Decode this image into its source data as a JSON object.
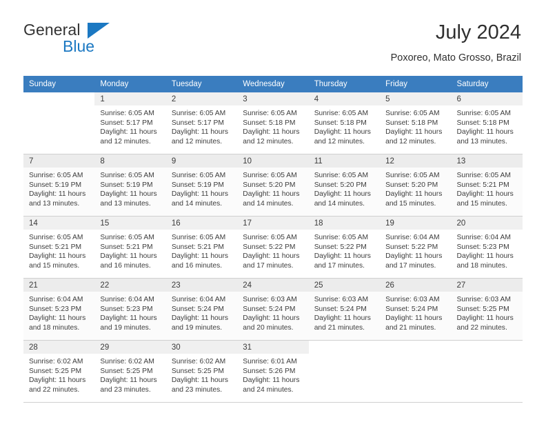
{
  "brand": {
    "name_dark": "General",
    "name_blue": "Blue",
    "accent_color": "#1b78c2"
  },
  "header": {
    "title": "July 2024",
    "subtitle": "Poxoreo, Mato Grosso, Brazil"
  },
  "calendar": {
    "header_bg": "#3a7dbf",
    "weekday_headers": [
      "Sunday",
      "Monday",
      "Tuesday",
      "Wednesday",
      "Thursday",
      "Friday",
      "Saturday"
    ],
    "weeks": [
      [
        {
          "day": "",
          "lines": []
        },
        {
          "day": "1",
          "lines": [
            "Sunrise: 6:05 AM",
            "Sunset: 5:17 PM",
            "Daylight: 11 hours",
            "and 12 minutes."
          ]
        },
        {
          "day": "2",
          "lines": [
            "Sunrise: 6:05 AM",
            "Sunset: 5:17 PM",
            "Daylight: 11 hours",
            "and 12 minutes."
          ]
        },
        {
          "day": "3",
          "lines": [
            "Sunrise: 6:05 AM",
            "Sunset: 5:18 PM",
            "Daylight: 11 hours",
            "and 12 minutes."
          ]
        },
        {
          "day": "4",
          "lines": [
            "Sunrise: 6:05 AM",
            "Sunset: 5:18 PM",
            "Daylight: 11 hours",
            "and 12 minutes."
          ]
        },
        {
          "day": "5",
          "lines": [
            "Sunrise: 6:05 AM",
            "Sunset: 5:18 PM",
            "Daylight: 11 hours",
            "and 12 minutes."
          ]
        },
        {
          "day": "6",
          "lines": [
            "Sunrise: 6:05 AM",
            "Sunset: 5:18 PM",
            "Daylight: 11 hours",
            "and 13 minutes."
          ]
        }
      ],
      [
        {
          "day": "7",
          "lines": [
            "Sunrise: 6:05 AM",
            "Sunset: 5:19 PM",
            "Daylight: 11 hours",
            "and 13 minutes."
          ]
        },
        {
          "day": "8",
          "lines": [
            "Sunrise: 6:05 AM",
            "Sunset: 5:19 PM",
            "Daylight: 11 hours",
            "and 13 minutes."
          ]
        },
        {
          "day": "9",
          "lines": [
            "Sunrise: 6:05 AM",
            "Sunset: 5:19 PM",
            "Daylight: 11 hours",
            "and 14 minutes."
          ]
        },
        {
          "day": "10",
          "lines": [
            "Sunrise: 6:05 AM",
            "Sunset: 5:20 PM",
            "Daylight: 11 hours",
            "and 14 minutes."
          ]
        },
        {
          "day": "11",
          "lines": [
            "Sunrise: 6:05 AM",
            "Sunset: 5:20 PM",
            "Daylight: 11 hours",
            "and 14 minutes."
          ]
        },
        {
          "day": "12",
          "lines": [
            "Sunrise: 6:05 AM",
            "Sunset: 5:20 PM",
            "Daylight: 11 hours",
            "and 15 minutes."
          ]
        },
        {
          "day": "13",
          "lines": [
            "Sunrise: 6:05 AM",
            "Sunset: 5:21 PM",
            "Daylight: 11 hours",
            "and 15 minutes."
          ]
        }
      ],
      [
        {
          "day": "14",
          "lines": [
            "Sunrise: 6:05 AM",
            "Sunset: 5:21 PM",
            "Daylight: 11 hours",
            "and 15 minutes."
          ]
        },
        {
          "day": "15",
          "lines": [
            "Sunrise: 6:05 AM",
            "Sunset: 5:21 PM",
            "Daylight: 11 hours",
            "and 16 minutes."
          ]
        },
        {
          "day": "16",
          "lines": [
            "Sunrise: 6:05 AM",
            "Sunset: 5:21 PM",
            "Daylight: 11 hours",
            "and 16 minutes."
          ]
        },
        {
          "day": "17",
          "lines": [
            "Sunrise: 6:05 AM",
            "Sunset: 5:22 PM",
            "Daylight: 11 hours",
            "and 17 minutes."
          ]
        },
        {
          "day": "18",
          "lines": [
            "Sunrise: 6:05 AM",
            "Sunset: 5:22 PM",
            "Daylight: 11 hours",
            "and 17 minutes."
          ]
        },
        {
          "day": "19",
          "lines": [
            "Sunrise: 6:04 AM",
            "Sunset: 5:22 PM",
            "Daylight: 11 hours",
            "and 17 minutes."
          ]
        },
        {
          "day": "20",
          "lines": [
            "Sunrise: 6:04 AM",
            "Sunset: 5:23 PM",
            "Daylight: 11 hours",
            "and 18 minutes."
          ]
        }
      ],
      [
        {
          "day": "21",
          "lines": [
            "Sunrise: 6:04 AM",
            "Sunset: 5:23 PM",
            "Daylight: 11 hours",
            "and 18 minutes."
          ]
        },
        {
          "day": "22",
          "lines": [
            "Sunrise: 6:04 AM",
            "Sunset: 5:23 PM",
            "Daylight: 11 hours",
            "and 19 minutes."
          ]
        },
        {
          "day": "23",
          "lines": [
            "Sunrise: 6:04 AM",
            "Sunset: 5:24 PM",
            "Daylight: 11 hours",
            "and 19 minutes."
          ]
        },
        {
          "day": "24",
          "lines": [
            "Sunrise: 6:03 AM",
            "Sunset: 5:24 PM",
            "Daylight: 11 hours",
            "and 20 minutes."
          ]
        },
        {
          "day": "25",
          "lines": [
            "Sunrise: 6:03 AM",
            "Sunset: 5:24 PM",
            "Daylight: 11 hours",
            "and 21 minutes."
          ]
        },
        {
          "day": "26",
          "lines": [
            "Sunrise: 6:03 AM",
            "Sunset: 5:24 PM",
            "Daylight: 11 hours",
            "and 21 minutes."
          ]
        },
        {
          "day": "27",
          "lines": [
            "Sunrise: 6:03 AM",
            "Sunset: 5:25 PM",
            "Daylight: 11 hours",
            "and 22 minutes."
          ]
        }
      ],
      [
        {
          "day": "28",
          "lines": [
            "Sunrise: 6:02 AM",
            "Sunset: 5:25 PM",
            "Daylight: 11 hours",
            "and 22 minutes."
          ]
        },
        {
          "day": "29",
          "lines": [
            "Sunrise: 6:02 AM",
            "Sunset: 5:25 PM",
            "Daylight: 11 hours",
            "and 23 minutes."
          ]
        },
        {
          "day": "30",
          "lines": [
            "Sunrise: 6:02 AM",
            "Sunset: 5:25 PM",
            "Daylight: 11 hours",
            "and 23 minutes."
          ]
        },
        {
          "day": "31",
          "lines": [
            "Sunrise: 6:01 AM",
            "Sunset: 5:26 PM",
            "Daylight: 11 hours",
            "and 24 minutes."
          ]
        },
        {
          "day": "",
          "lines": []
        },
        {
          "day": "",
          "lines": []
        },
        {
          "day": "",
          "lines": []
        }
      ]
    ]
  }
}
